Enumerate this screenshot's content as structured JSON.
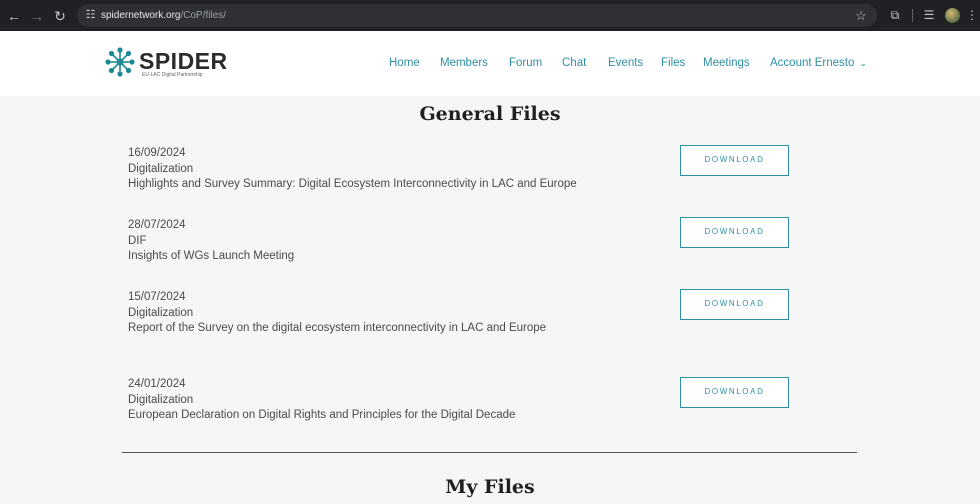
{
  "browser": {
    "url_host": "spidernetwork.org",
    "url_path": "/CoP/files/"
  },
  "site": {
    "logo_text": "SPIDER",
    "logo_subtitle": "EU-LAC Digital Partnership",
    "nav": [
      {
        "label": "Home"
      },
      {
        "label": "Members"
      },
      {
        "label": "Forum"
      },
      {
        "label": "Chat"
      },
      {
        "label": "Events"
      },
      {
        "label": "Files"
      },
      {
        "label": "Meetings"
      },
      {
        "label": "Account Ernesto"
      }
    ]
  },
  "general_files": {
    "title": "General Files",
    "items": [
      {
        "date": "16/09/2024",
        "category": "Digitalization",
        "name": "Highlights and Survey Summary: Digital Ecosystem Interconnectivity in LAC and Europe",
        "button": "DOWNLOAD"
      },
      {
        "date": "28/07/2024",
        "category": "DIF",
        "name": "Insights of WGs Launch Meeting",
        "button": "DOWNLOAD"
      },
      {
        "date": "15/07/2024",
        "category": "Digitalization",
        "name": "Report of the Survey on the digital ecosystem interconnectivity in LAC and Europe",
        "button": "DOWNLOAD"
      },
      {
        "date": "24/01/2024",
        "category": "Digitalization",
        "name": "European Declaration on Digital Rights and Principles for the Digital Decade",
        "button": "DOWNLOAD"
      }
    ]
  },
  "my_files": {
    "title": "My Files"
  },
  "colors": {
    "accent": "#2e8fa3",
    "chrome_bg": "#202124",
    "page_bg": "#f6f6f6"
  },
  "icons": {
    "back": "arrow-left-icon",
    "forward": "arrow-right-icon",
    "reload": "reload-icon",
    "site_info": "site-info-icon",
    "bookmark": "star-icon",
    "extensions": "puzzle-icon",
    "media": "media-control-icon",
    "menu": "kebab-menu-icon"
  }
}
